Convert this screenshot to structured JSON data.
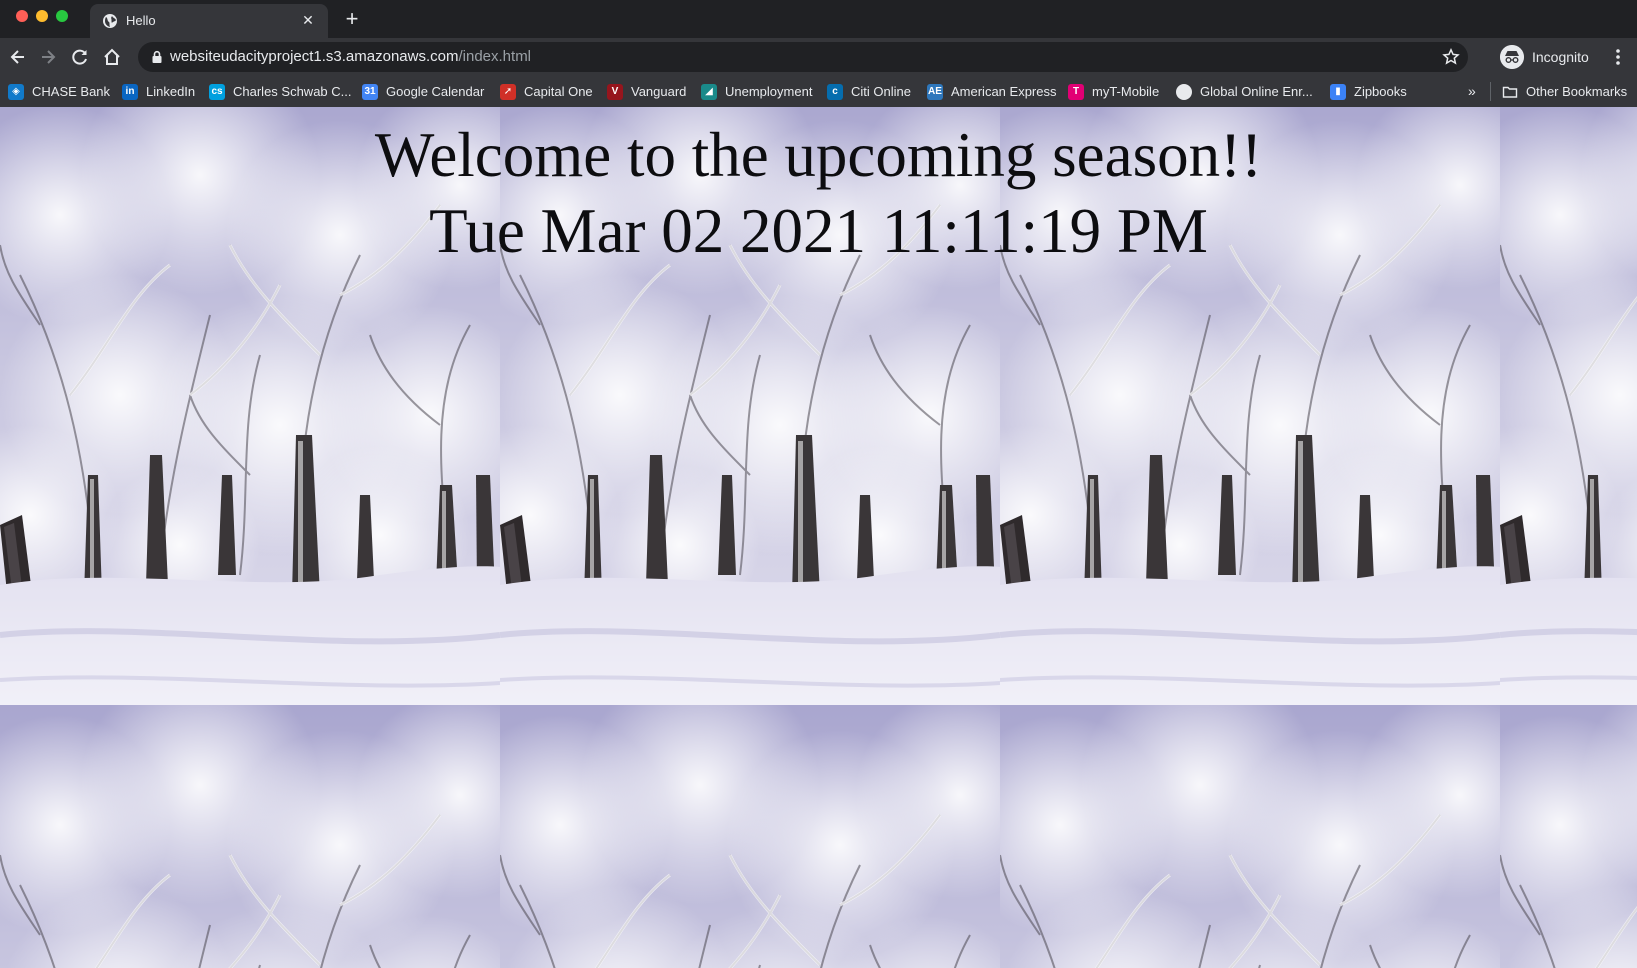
{
  "window": {
    "tab_title": "Hello",
    "new_tab_symbol": "+",
    "tab_close_symbol": "✕"
  },
  "toolbar": {
    "url_host": "websiteudacityproject1.s3.amazonaws.com",
    "url_path": "/index.html",
    "profile_label": "Incognito"
  },
  "bookmarks": {
    "items": [
      {
        "label": "CHASE Bank",
        "icon": "chase-icon",
        "color": "#117aca"
      },
      {
        "label": "LinkedIn",
        "icon": "linkedin-icon",
        "color": "#0a66c2"
      },
      {
        "label": "Charles Schwab C...",
        "icon": "schwab-icon",
        "color": "#00a0df"
      },
      {
        "label": "Google Calendar",
        "icon": "google-calendar-icon",
        "color": "#4285f4"
      },
      {
        "label": "Capital One",
        "icon": "capital-one-icon",
        "color": "#d03027"
      },
      {
        "label": "Vanguard",
        "icon": "vanguard-icon",
        "color": "#96151d"
      },
      {
        "label": "Unemployment",
        "icon": "unemployment-icon",
        "color": "#1a8a8a"
      },
      {
        "label": "Citi Online",
        "icon": "citi-icon",
        "color": "#056dae"
      },
      {
        "label": "American Express",
        "icon": "amex-icon",
        "color": "#2e77bc"
      },
      {
        "label": "myT-Mobile",
        "icon": "t-mobile-icon",
        "color": "#e20074"
      },
      {
        "label": "Global Online Enr...",
        "icon": "globe-icon",
        "color": "#e8eaed"
      },
      {
        "label": "Zipbooks",
        "icon": "zipbooks-icon",
        "color": "#3b82f6"
      }
    ],
    "overflow_symbol": "»",
    "other_label": "Other Bookmarks"
  },
  "page": {
    "headline": "Welcome to the upcoming season!!",
    "datetime": "Tue Mar 02 2021 11:11:19 PM"
  },
  "colors": {
    "tab_bar": "#202124",
    "toolbar": "#35363a",
    "snow": "#e9e8f3",
    "sky": "#b9b6d6",
    "bark": "#3a3638",
    "heading_text": "#0d0d10"
  }
}
